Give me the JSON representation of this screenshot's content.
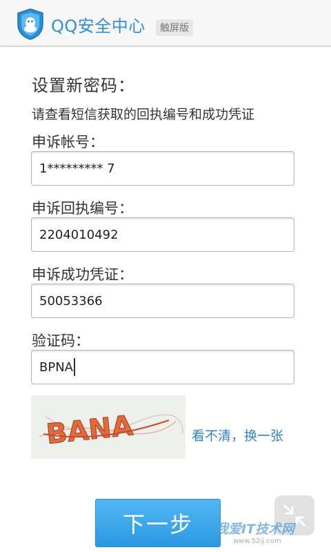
{
  "header": {
    "title": "QQ安全中心",
    "badge": "触屏版",
    "logo_icon": "qq-shield-icon"
  },
  "form": {
    "heading": "设置新密码：",
    "instruction": "请查看短信获取的回执编号和成功凭证",
    "fields": [
      {
        "label": "申诉帐号：",
        "value": "1********* 7"
      },
      {
        "label": "申诉回执编号：",
        "value": "2204010492"
      },
      {
        "label": "申诉成功凭证：",
        "value": "50053366"
      },
      {
        "label": "验证码：",
        "value": "BPNA"
      }
    ],
    "captcha": {
      "text": "BANA",
      "refresh_label": "看不清，换一张"
    },
    "submit_label": "下一步"
  },
  "overlay": {
    "float_icon": "shrink-arrows-icon",
    "watermark": "我爱IT技术网",
    "watermark_url": "www.52ij.com"
  },
  "colors": {
    "accent": "#2f8fd8",
    "button": "#3aa6ea",
    "link": "#2f84c8"
  }
}
